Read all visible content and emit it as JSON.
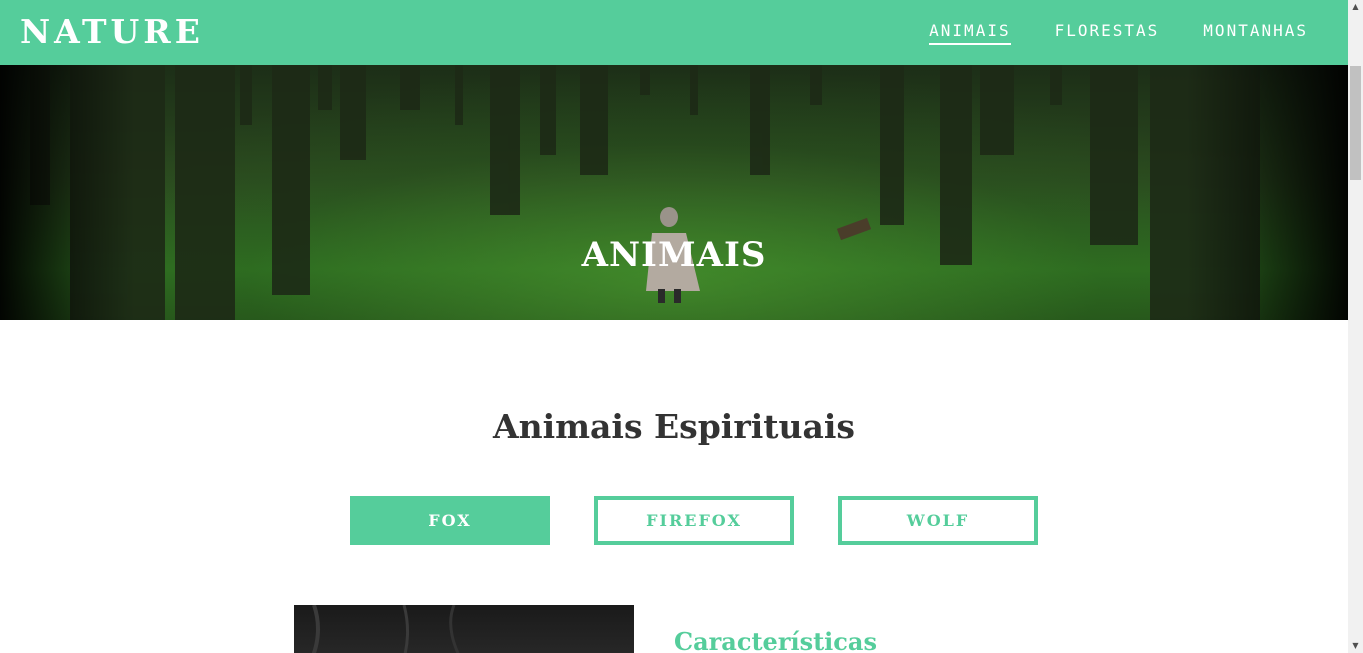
{
  "header": {
    "logo": "NATURE",
    "nav": [
      {
        "label": "ANIMAIS",
        "active": true
      },
      {
        "label": "FLORESTAS",
        "active": false
      },
      {
        "label": "MONTANHAS",
        "active": false
      }
    ]
  },
  "hero": {
    "title": "ANIMAIS"
  },
  "section": {
    "title": "Animais Espirituais",
    "tabs": [
      {
        "label": "FOX",
        "selected": true
      },
      {
        "label": "FIREFOX",
        "selected": false
      },
      {
        "label": "WOLF",
        "selected": false
      }
    ],
    "content_title": "Características"
  },
  "colors": {
    "accent": "#55cd9b",
    "heading": "#333333",
    "background": "#ffffff"
  },
  "icons": {
    "scroll_up": "arrow-up-icon",
    "scroll_down": "arrow-down-icon"
  }
}
